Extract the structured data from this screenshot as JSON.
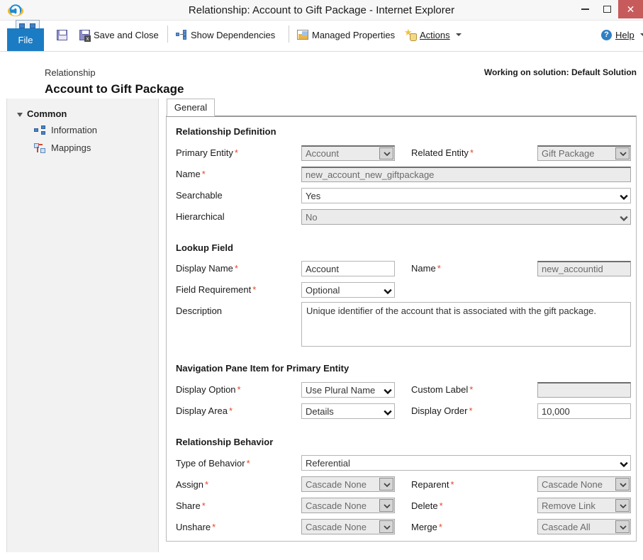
{
  "window": {
    "title": "Relationship: Account to Gift Package - Internet Explorer",
    "app_icon": "internet-explorer-icon",
    "controls": {
      "minimize": "minimize-icon",
      "maximize": "maximize-icon",
      "close": "✕"
    },
    "close_button_color": "#c75b5b"
  },
  "ribbon": {
    "file_tab": "File",
    "file_tab_color": "#1b7cc4",
    "commands": [
      {
        "label": "",
        "icon": "save-icon"
      },
      {
        "label": "Save and Close",
        "icon": "save-and-close-icon"
      },
      {
        "label": "Show Dependencies",
        "icon": "dependencies-icon"
      },
      {
        "label": "Managed Properties",
        "icon": "managed-properties-icon"
      },
      {
        "label": "Actions",
        "icon": "actions-icon",
        "has_dropdown": true
      }
    ],
    "help": {
      "label": "Help",
      "icon": "help-icon",
      "has_dropdown": true
    }
  },
  "header": {
    "subtitle": "Relationship",
    "title": "Account to Gift Package",
    "solution": "Working on solution: Default Solution",
    "icon": "relationship-icon"
  },
  "sidebar": {
    "group": "Common",
    "items": [
      {
        "label": "Information",
        "icon": "information-icon"
      },
      {
        "label": "Mappings",
        "icon": "mappings-icon"
      }
    ]
  },
  "tabs": [
    {
      "label": "General",
      "active": true
    }
  ],
  "sections": {
    "relationship_definition": {
      "title": "Relationship Definition",
      "primary_entity": {
        "label": "Primary Entity",
        "required": true,
        "value": "Account",
        "type": "select",
        "disabled": true
      },
      "related_entity": {
        "label": "Related Entity",
        "required": true,
        "value": "Gift Package",
        "type": "select",
        "disabled": true
      },
      "name": {
        "label": "Name",
        "required": true,
        "value": "new_account_new_giftpackage",
        "type": "text",
        "disabled": true
      },
      "searchable": {
        "label": "Searchable",
        "required": false,
        "value": "Yes",
        "type": "select",
        "disabled": false
      },
      "hierarchical": {
        "label": "Hierarchical",
        "required": false,
        "value": "No",
        "type": "select",
        "disabled": true
      }
    },
    "lookup_field": {
      "title": "Lookup Field",
      "display_name": {
        "label": "Display Name",
        "required": true,
        "value": "Account",
        "type": "text",
        "disabled": false
      },
      "name": {
        "label": "Name",
        "required": true,
        "value": "new_accountid",
        "type": "text",
        "disabled": true
      },
      "field_requirement": {
        "label": "Field Requirement",
        "required": true,
        "value": "Optional",
        "type": "select",
        "disabled": false
      },
      "description": {
        "label": "Description",
        "required": false,
        "value": "Unique identifier of the account that is associated with the gift package.",
        "type": "textarea"
      }
    },
    "navigation_pane": {
      "title": "Navigation Pane Item for Primary Entity",
      "display_option": {
        "label": "Display Option",
        "required": true,
        "value": "Use Plural Name",
        "type": "select",
        "disabled": false
      },
      "custom_label": {
        "label": "Custom Label",
        "required": true,
        "value": "",
        "type": "text",
        "disabled": true
      },
      "display_area": {
        "label": "Display Area",
        "required": true,
        "value": "Details",
        "type": "select",
        "disabled": false
      },
      "display_order": {
        "label": "Display Order",
        "required": true,
        "value": "10,000",
        "type": "text",
        "disabled": false
      }
    },
    "relationship_behavior": {
      "title": "Relationship Behavior",
      "type_of_behavior": {
        "label": "Type of Behavior",
        "required": true,
        "value": "Referential",
        "type": "select",
        "disabled": false
      },
      "assign": {
        "label": "Assign",
        "required": true,
        "value": "Cascade None",
        "type": "select",
        "disabled": true
      },
      "reparent": {
        "label": "Reparent",
        "required": true,
        "value": "Cascade None",
        "type": "select",
        "disabled": true
      },
      "share": {
        "label": "Share",
        "required": true,
        "value": "Cascade None",
        "type": "select",
        "disabled": true
      },
      "delete": {
        "label": "Delete",
        "required": true,
        "value": "Remove Link",
        "type": "select",
        "disabled": true
      },
      "unshare": {
        "label": "Unshare",
        "required": true,
        "value": "Cascade None",
        "type": "select",
        "disabled": true
      },
      "merge": {
        "label": "Merge",
        "required": true,
        "value": "Cascade All",
        "type": "select",
        "disabled": true
      }
    }
  }
}
